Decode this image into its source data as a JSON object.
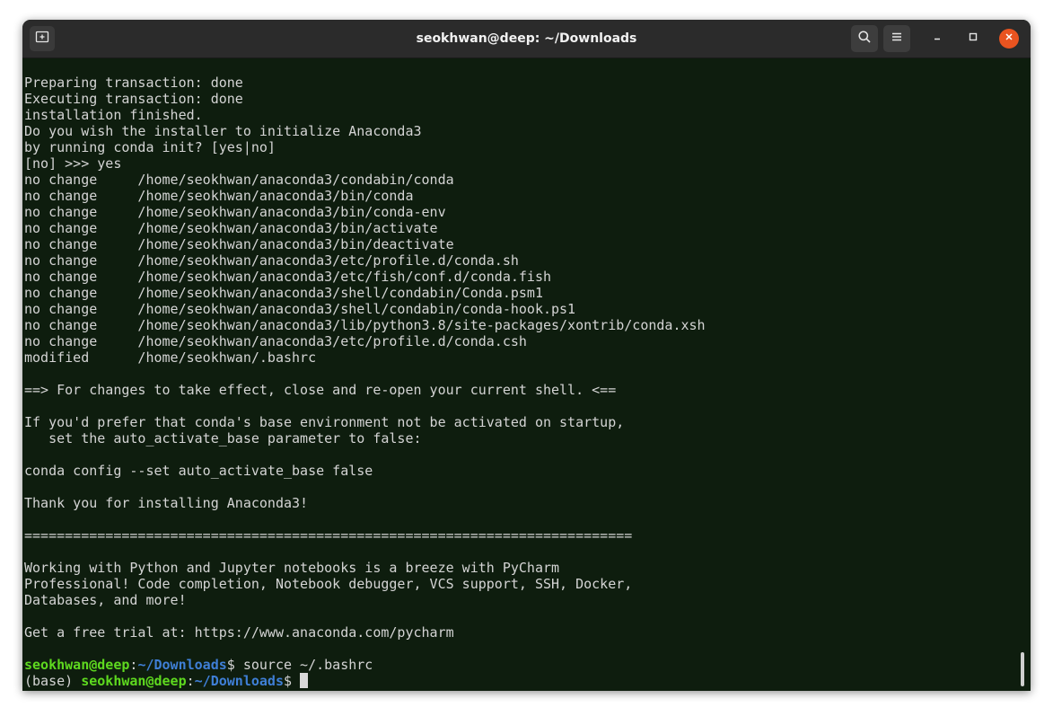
{
  "window": {
    "title": "seokhwan@deep: ~/Downloads"
  },
  "icons": {
    "new_tab": "new-tab-icon",
    "search": "search-icon",
    "menu": "hamburger-menu-icon",
    "minimize": "minimize-icon",
    "maximize": "maximize-icon",
    "close": "close-icon"
  },
  "colors": {
    "terminal_bg": "#0e1d0e",
    "prompt_user": "#5ed91f",
    "prompt_path": "#3f7fd6",
    "close_button": "#e95420"
  },
  "terminal": {
    "lines": [
      "Preparing transaction: done",
      "Executing transaction: done",
      "installation finished.",
      "Do you wish the installer to initialize Anaconda3",
      "by running conda init? [yes|no]",
      "[no] >>> yes",
      "no change     /home/seokhwan/anaconda3/condabin/conda",
      "no change     /home/seokhwan/anaconda3/bin/conda",
      "no change     /home/seokhwan/anaconda3/bin/conda-env",
      "no change     /home/seokhwan/anaconda3/bin/activate",
      "no change     /home/seokhwan/anaconda3/bin/deactivate",
      "no change     /home/seokhwan/anaconda3/etc/profile.d/conda.sh",
      "no change     /home/seokhwan/anaconda3/etc/fish/conf.d/conda.fish",
      "no change     /home/seokhwan/anaconda3/shell/condabin/Conda.psm1",
      "no change     /home/seokhwan/anaconda3/shell/condabin/conda-hook.ps1",
      "no change     /home/seokhwan/anaconda3/lib/python3.8/site-packages/xontrib/conda.xsh",
      "no change     /home/seokhwan/anaconda3/etc/profile.d/conda.csh",
      "modified      /home/seokhwan/.bashrc",
      "",
      "==> For changes to take effect, close and re-open your current shell. <==",
      "",
      "If you'd prefer that conda's base environment not be activated on startup,",
      "   set the auto_activate_base parameter to false:",
      "",
      "conda config --set auto_activate_base false",
      "",
      "Thank you for installing Anaconda3!",
      "",
      "===========================================================================",
      "",
      "Working with Python and Jupyter notebooks is a breeze with PyCharm",
      "Professional! Code completion, Notebook debugger, VCS support, SSH, Docker,",
      "Databases, and more!",
      "",
      "Get a free trial at: https://www.anaconda.com/pycharm",
      ""
    ],
    "prompt1": {
      "user": "seokhwan@deep",
      "sep": ":",
      "path": "~/Downloads",
      "dollar": "$",
      "command": " source ~/.bashrc"
    },
    "prompt2": {
      "env": "(base) ",
      "user": "seokhwan@deep",
      "sep": ":",
      "path": "~/Downloads",
      "dollar": "$",
      "command": " "
    }
  }
}
